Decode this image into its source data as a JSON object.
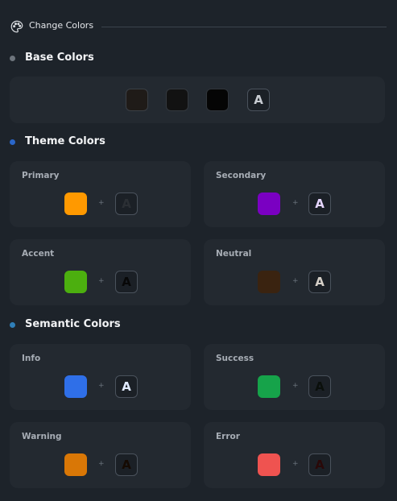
{
  "header": {
    "title": "Change Colors",
    "icon": "palette-icon"
  },
  "base": {
    "title": "Base Colors",
    "dot_color": "#6e757d",
    "swatches": [
      "#1f1b18",
      "#121212",
      "#050505"
    ],
    "letter": "A",
    "letter_color": "#c8ccd2"
  },
  "theme": {
    "title": "Theme Colors",
    "dot_color": "#2a66c9",
    "cards": [
      {
        "label": "Primary",
        "color": "#ff9900",
        "letter": "A",
        "letter_color": "#2b2f34"
      },
      {
        "label": "Secondary",
        "color": "#7a00c2",
        "letter": "A",
        "letter_color": "#e6d6ff"
      },
      {
        "label": "Accent",
        "color": "#4caf0f",
        "letter": "A",
        "letter_color": "#070707"
      },
      {
        "label": "Neutral",
        "color": "#3a2310",
        "letter": "A",
        "letter_color": "#d6d0c8"
      }
    ]
  },
  "semantic": {
    "title": "Semantic Colors",
    "dot_color": "#2f7fb8",
    "cards": [
      {
        "label": "Info",
        "color": "#2f6fe8",
        "letter": "A",
        "letter_color": "#e1ebff"
      },
      {
        "label": "Success",
        "color": "#16a34a",
        "letter": "A",
        "letter_color": "#0a0f0b"
      },
      {
        "label": "Warning",
        "color": "#d97706",
        "letter": "A",
        "letter_color": "#150a02"
      },
      {
        "label": "Error",
        "color": "#ef5350",
        "letter": "A",
        "letter_color": "#2a0808"
      }
    ]
  },
  "plus_sign": "+"
}
